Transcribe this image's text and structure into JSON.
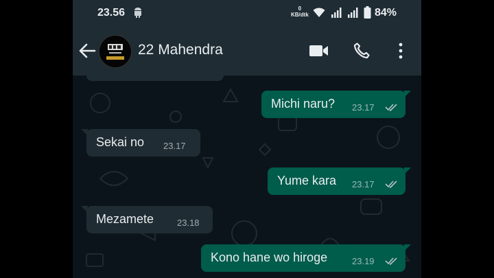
{
  "status_bar": {
    "time": "23.56",
    "net_speed_value": "0",
    "net_speed_unit": "KB/dtk",
    "battery": "84%"
  },
  "header": {
    "contact_name": "22 Mahendra",
    "icons": [
      "back-arrow-icon",
      "video-call-icon",
      "phone-icon",
      "more-options-icon"
    ]
  },
  "messages": [
    {
      "direction": "out",
      "text": "Michi naru?",
      "time": "23.17",
      "status": "read"
    },
    {
      "direction": "in",
      "text": "Sekai no",
      "time": "23.17"
    },
    {
      "direction": "out",
      "text": "Yume kara",
      "time": "23.17",
      "status": "read"
    },
    {
      "direction": "in",
      "text": "Mezamete",
      "time": "23.18"
    },
    {
      "direction": "out",
      "text": "Kono hane wo hiroge",
      "time": "23.19",
      "status": "read"
    }
  ],
  "colors": {
    "outgoing_bubble": "#005c4b",
    "incoming_bubble": "#202c33",
    "chat_background": "#0b141a",
    "header_background": "#1f2c34"
  }
}
